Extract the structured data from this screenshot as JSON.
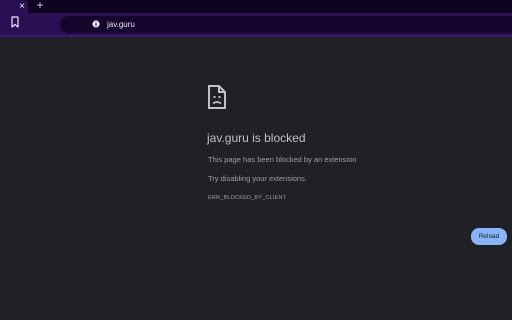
{
  "tabbar": {
    "close_glyph": "×",
    "new_tab_glyph": "+"
  },
  "toolbar": {
    "url": "jav.guru",
    "bookmark_icon": "bookmark-icon",
    "info_icon": "info-icon"
  },
  "error_page": {
    "icon": "sad-document-icon",
    "title": "jav.guru is blocked",
    "message": "This page has been blocked by an extension",
    "suggestion": "Try disabling your extensions.",
    "code": "ERR_BLOCKED_BY_CLIENT",
    "reload_label": "Reload"
  },
  "colors": {
    "page_background": "#202124",
    "toolbar_background": "#2a0f55",
    "tabbar_background": "#0f0420",
    "reload_button": "#8ab4f8"
  }
}
